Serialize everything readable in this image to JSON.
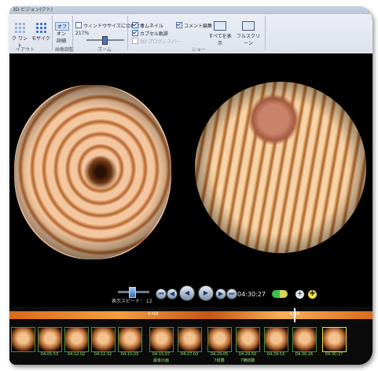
{
  "window": {
    "title": "3D ビジョン(クト)"
  },
  "ribbon": {
    "layout": {
      "grid_label": "ク ワント",
      "mosaic_label": "モザイク",
      "group_label": "イアウト"
    },
    "image_adjust": {
      "items": [
        "オフ",
        "オン",
        "詳細"
      ],
      "group_label": "画像調整"
    },
    "zoom": {
      "fit_label": "ウィンドウサイズに合わせる",
      "percent": "217%",
      "group_label": "ズーム"
    },
    "view": {
      "thumbnail_label": "サムネイル",
      "caption_label": "カプセル軌跡",
      "disabled_label": "3D プログレスバー",
      "comment_label": "コメント編集",
      "show_all_label": "すべてを表示",
      "fullscreen_label": "フルスクリーン",
      "group_label": "ショー"
    }
  },
  "playback": {
    "speed_label": "表示スピード： 12",
    "time": "04:30:27",
    "buttons": [
      "first",
      "prev",
      "rewind",
      "play",
      "fast",
      "last"
    ]
  },
  "timeline": {
    "labels": [
      "4:00",
      "4:30"
    ],
    "thumbs": [
      {
        "time": "",
        "caption": ""
      },
      {
        "time": "04:05:53",
        "caption": ""
      },
      {
        "time": "04:12:02",
        "caption": ""
      },
      {
        "time": "04:12:32",
        "caption": ""
      },
      {
        "time": "04:15:03",
        "caption": ""
      },
      {
        "time": "04:15:07",
        "caption": "最後の画"
      },
      {
        "time": "04:27:03",
        "caption": ""
      },
      {
        "time": "04:29:05",
        "caption": "7結腸"
      },
      {
        "time": "04:29:50",
        "caption": "7横結腸"
      },
      {
        "time": "04:29:53",
        "caption": ""
      },
      {
        "time": "04:30:26",
        "caption": ""
      },
      {
        "time": "04:30:27",
        "caption": ""
      }
    ]
  },
  "colors": {
    "accent": "#3b6fc4",
    "timeline": "#e08a30",
    "thumb_caption": "#9fe07a"
  }
}
